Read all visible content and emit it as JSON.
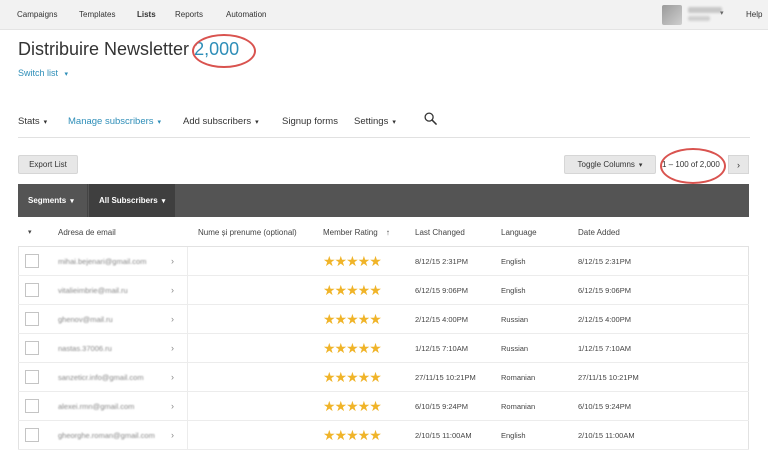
{
  "topnav": {
    "items": [
      "Campaigns",
      "Templates",
      "Lists",
      "Reports",
      "Automation"
    ],
    "active": "Lists",
    "help": "Help"
  },
  "header": {
    "title": "Distribuire Newsletter",
    "count": "2,000",
    "switch_list": "Switch list"
  },
  "subnav": {
    "stats": "Stats",
    "manage": "Manage subscribers",
    "add": "Add subscribers",
    "signup": "Signup forms",
    "settings": "Settings"
  },
  "toolbar": {
    "export": "Export List",
    "toggle_columns": "Toggle Columns",
    "pager": "1 – 100 of 2,000",
    "next": "›"
  },
  "filterbar": {
    "segments": "Segments",
    "all_subscribers": "All Subscribers"
  },
  "table": {
    "columns": [
      "Adresa de email",
      "Nume și prenume (optional)",
      "Member Rating",
      "Last Changed",
      "Language",
      "Date Added"
    ],
    "sort_indicator": "↑",
    "rows": [
      {
        "email": "mihai.bejenari@gmail.com",
        "rating": 5,
        "last_changed": "8/12/15 2:31PM",
        "language": "English",
        "date_added": "8/12/15 2:31PM"
      },
      {
        "email": "vitalieimbrie@mail.ru",
        "rating": 5,
        "last_changed": "6/12/15 9:06PM",
        "language": "English",
        "date_added": "6/12/15 9:06PM"
      },
      {
        "email": "ghenov@mail.ru",
        "rating": 5,
        "last_changed": "2/12/15 4:00PM",
        "language": "Russian",
        "date_added": "2/12/15 4:00PM"
      },
      {
        "email": "nastas.37006.ru",
        "rating": 5,
        "last_changed": "1/12/15 7:10AM",
        "language": "Russian",
        "date_added": "1/12/15 7:10AM"
      },
      {
        "email": "sanzeticr.info@gmail.com",
        "rating": 5,
        "last_changed": "27/11/15 10:21PM",
        "language": "Romanian",
        "date_added": "27/11/15 10:21PM"
      },
      {
        "email": "alexei.rmn@gmail.com",
        "rating": 5,
        "last_changed": "6/10/15 9:24PM",
        "language": "Romanian",
        "date_added": "6/10/15 9:24PM"
      },
      {
        "email": "gheorghe.roman@gmail.com",
        "rating": 5,
        "last_changed": "2/10/15 11:00AM",
        "language": "English",
        "date_added": "2/10/15 11:00AM"
      }
    ]
  },
  "colors": {
    "accent": "#2e8eb8",
    "annotation": "#d9534f",
    "star": "#f0b429",
    "dark_bar": "#545454"
  }
}
